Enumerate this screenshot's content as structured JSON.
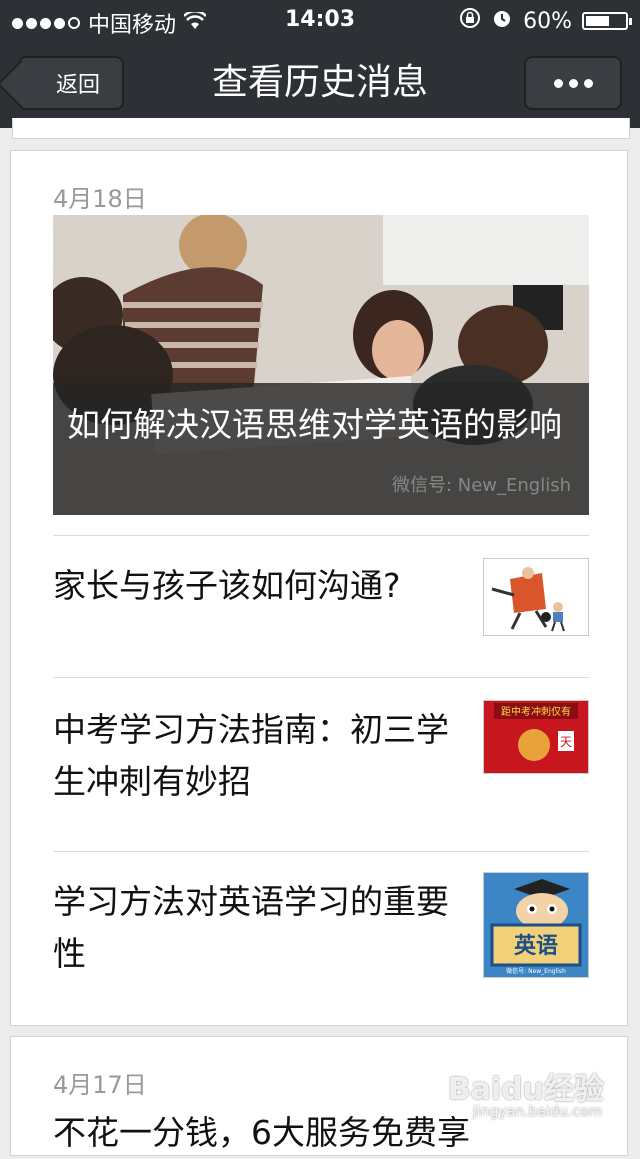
{
  "status_bar": {
    "carrier": "中国移动",
    "time": "14:03",
    "battery": "60%",
    "battery_level": 0.6
  },
  "nav": {
    "back_label": "返回",
    "title": "查看历史消息"
  },
  "groups": [
    {
      "date": "4月18日",
      "featured": {
        "title": "如何解决汉语思维对学英语的影响",
        "watermark": "微信号: New_English"
      },
      "items": [
        {
          "title": "家长与孩子该如何沟通?"
        },
        {
          "title": "中考学习方法指南：初三学生冲刺有妙招",
          "thumb_text": "距中考冲刺仅有",
          "thumb_text2": "天"
        },
        {
          "title": "学习方法对英语学习的重要性",
          "thumb_text": "英语",
          "thumb_text2": "微信号: New_English"
        }
      ]
    },
    {
      "date": "4月17日",
      "first_title": "不花一分钱，6大服务免费享"
    }
  ],
  "watermark": {
    "brand": "Baidu经验",
    "sub": "jingyan.baidu.com"
  }
}
